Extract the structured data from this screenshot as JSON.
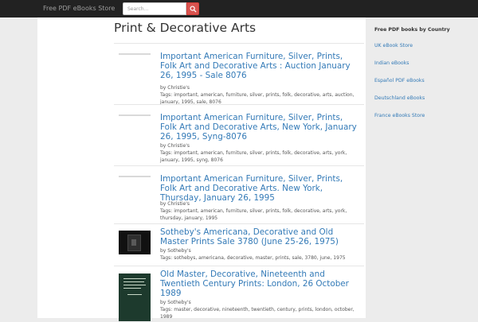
{
  "navbar": {
    "brand": "Free PDF eBooks Store",
    "search_placeholder": "Search...",
    "search_icon": "search-icon",
    "search_button_color": "#d9534f"
  },
  "page": {
    "title": "Print & Decorative Arts"
  },
  "books": [
    {
      "title": "Important American Furniture, Silver, Prints, Folk Art and Decorative Arts : Auction January 26, 1995 - Sale 8076",
      "by": "by Christie's",
      "tags": "Tags: important, american, furniture, silver, prints, folk, decorative, arts, auction, january, 1995, sale, 8076"
    },
    {
      "title": "Important American Furniture, Silver, Prints, Folk Art and Decorative Arts, New York, January 26, 1995, Syng-8076",
      "by": "by Christie's",
      "tags": "Tags: important, american, furniture, silver, prints, folk, decorative, arts, york, january, 1995, syng, 8076"
    },
    {
      "title": "Important American Furniture, Silver, Prints, Folk Art and Decorative Arts. New York, Thursday, January 26, 1995",
      "by": "by Christie's",
      "tags": "Tags: important, american, furniture, silver, prints, folk, decorative, arts, york, thursday, january, 1995"
    },
    {
      "title": "Sotheby's Americana, Decorative and Old Master Prints Sale 3780 (June 25-26, 1975)",
      "by": "by Sotheby's",
      "tags": "Tags: sothebys, americana, decorative, master, prints, sale, 3780, june, 1975"
    },
    {
      "title": "Old Master, Decorative, Nineteenth and Twentieth Century Prints: London, 26 October 1989",
      "by": "by Sotheby's",
      "tags": "Tags: master, decorative, nineteenth, twentieth, century, prints, london, october, 1989"
    }
  ],
  "sidebar": {
    "heading": "Free PDF books by Country",
    "links": [
      "UK eBook Store",
      "Indian eBooks",
      "Español PDF eBooks",
      "Deutschland eBooks",
      "France eBooks Store"
    ]
  }
}
